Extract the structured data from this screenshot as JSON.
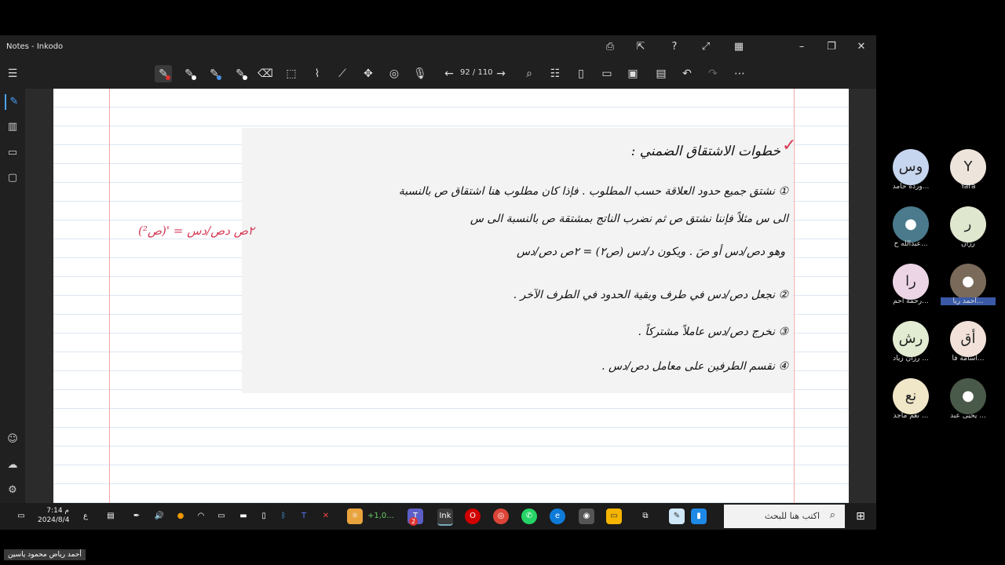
{
  "window": {
    "title": "Notes - Inkodo"
  },
  "toolbar": {
    "page_counter": "92 / 110"
  },
  "notes": {
    "heading": "خطوات الاشتقاق الضمني :",
    "step1a": "① نشتق جميع حدود العلاقة حسب المطلوب . فإذا كان مطلوب هنا اشتقاق ص بالنسبة",
    "step1b": "الى س مثلاً فإننا نشتق ص ثم نضرب الناتج بمشتقة ص بالنسبة الى س",
    "step1c": "وهو دص/دس أو صَ . ويكون د/دس (ص٢) = ٢ص دص/دس",
    "step2": "② نجعل دص/دس في طرف وبقية الحدود في الطرف الآخر .",
    "step3": "③ نخرج دص/دس عاملاً مشتركاً .",
    "step4": "④ نقسم الطرفين على معامل دص/دس .",
    "red_note": "(ص²)' = ٢ص دص/دس"
  },
  "taskbar": {
    "search_placeholder": "اكتب هنا للبحث",
    "time": "7:14 م",
    "date": "2024/8/4",
    "lang": "ع",
    "badge_count": "2",
    "weather": "+1,0..."
  },
  "participants": [
    {
      "initials": "وس",
      "name": "ورده حامد...",
      "color": "#c7d6ef"
    },
    {
      "initials": "Y",
      "name": "Yara",
      "color": "#ede4dc"
    },
    {
      "initials": "",
      "name": "عبدالله ح...",
      "color": "#4a7a8c"
    },
    {
      "initials": "ر",
      "name": "رزان",
      "color": "#dfe8cf"
    },
    {
      "initials": "را",
      "name": "رحمة احم...",
      "color": "#ecd6e6"
    },
    {
      "initials": "",
      "name": "أحمد ريا...",
      "color": "#7a6a5a"
    },
    {
      "initials": "رش",
      "name": "رزان زياد ...",
      "color": "#e2ecd2"
    },
    {
      "initials": "أق",
      "name": "أسامة فا...",
      "color": "#f1e1d8"
    },
    {
      "initials": "نع",
      "name": "نغم ماجد ...",
      "color": "#f0e6c8"
    },
    {
      "initials": "",
      "name": "يحيى عبد ...",
      "color": "#4a5a4a"
    }
  ],
  "speaker_label": "أحمد رياض محمود ياسين"
}
